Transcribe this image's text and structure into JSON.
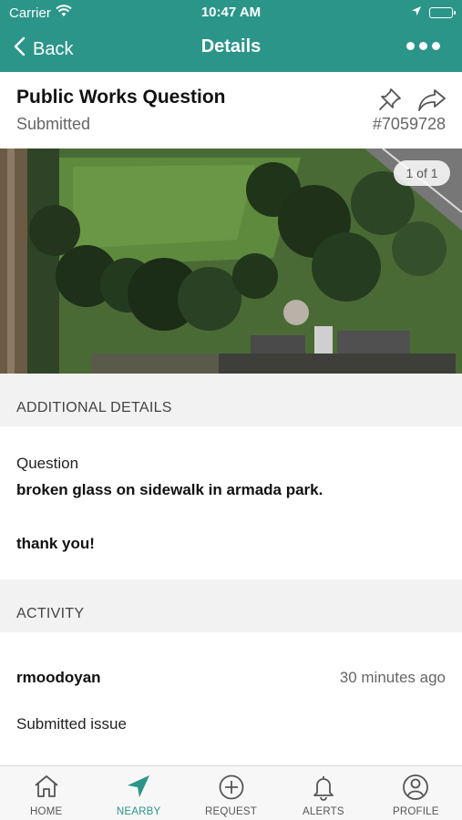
{
  "status_bar": {
    "carrier": "Carrier",
    "time": "10:47 AM"
  },
  "nav": {
    "back_label": "Back",
    "title": "Details"
  },
  "request": {
    "title": "Public Works Question",
    "status": "Submitted",
    "id": "#7059728",
    "photo_count": "1 of 1"
  },
  "additional_details": {
    "header": "ADDITIONAL DETAILS",
    "question_label": "Question",
    "answer_line1": "broken glass on sidewalk in armada park.",
    "answer_line2": "thank you!"
  },
  "activity": {
    "header": "ACTIVITY",
    "entries": [
      {
        "user": "rmoodoyan",
        "time": "30 minutes ago",
        "action": "Submitted issue"
      }
    ]
  },
  "tabs": [
    {
      "label": "HOME",
      "icon": "home-icon"
    },
    {
      "label": "NEARBY",
      "icon": "location-arrow-icon"
    },
    {
      "label": "REQUEST",
      "icon": "plus-circle-icon"
    },
    {
      "label": "ALERTS",
      "icon": "bell-icon"
    },
    {
      "label": "PROFILE",
      "icon": "user-icon"
    }
  ],
  "colors": {
    "brand": "#2b958a",
    "active_tab": "#2b958a"
  },
  "active_tab": "NEARBY"
}
